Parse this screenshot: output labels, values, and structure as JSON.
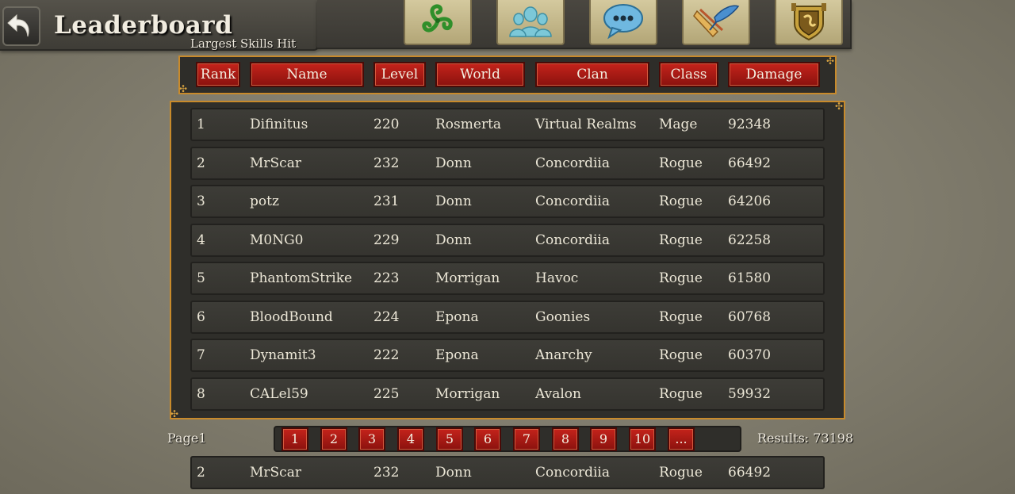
{
  "header": {
    "title": "Leaderboard",
    "subtitle": "Largest Skills Hit",
    "back_icon": "back-arrow-icon"
  },
  "menu": [
    {
      "name": "menu-button-skills",
      "icon": "triskelion-icon"
    },
    {
      "name": "menu-button-social",
      "icon": "friends-icon"
    },
    {
      "name": "menu-button-chat",
      "icon": "chat-bubble-icon"
    },
    {
      "name": "menu-button-quests",
      "icon": "scroll-quill-icon"
    },
    {
      "name": "menu-button-shop",
      "icon": "shield-emblem-icon"
    }
  ],
  "columns": [
    "Rank",
    "Name",
    "Level",
    "World",
    "Clan",
    "Class",
    "Damage"
  ],
  "rows": [
    {
      "rank": "1",
      "name": "Difinitus",
      "level": "220",
      "world": "Rosmerta",
      "clan": "Virtual Realms",
      "class": "Mage",
      "damage": "92348"
    },
    {
      "rank": "2",
      "name": "MrScar",
      "level": "232",
      "world": "Donn",
      "clan": "Concordiia",
      "class": "Rogue",
      "damage": "66492"
    },
    {
      "rank": "3",
      "name": "potz",
      "level": "231",
      "world": "Donn",
      "clan": "Concordiia",
      "class": "Rogue",
      "damage": "64206"
    },
    {
      "rank": "4",
      "name": "M0NG0",
      "level": "229",
      "world": "Donn",
      "clan": "Concordiia",
      "class": "Rogue",
      "damage": "62258"
    },
    {
      "rank": "5",
      "name": "PhantomStrike",
      "level": "223",
      "world": "Morrigan",
      "clan": "Havoc",
      "class": "Rogue",
      "damage": "61580"
    },
    {
      "rank": "6",
      "name": "BloodBound",
      "level": "224",
      "world": "Epona",
      "clan": "Goonies",
      "class": "Rogue",
      "damage": "60768"
    },
    {
      "rank": "7",
      "name": "Dynamit3",
      "level": "222",
      "world": "Epona",
      "clan": "Anarchy",
      "class": "Rogue",
      "damage": "60370"
    },
    {
      "rank": "8",
      "name": "CALel59",
      "level": "225",
      "world": "Morrigan",
      "clan": "Avalon",
      "class": "Rogue",
      "damage": "59932"
    }
  ],
  "pagination": {
    "page_label": "Page1",
    "pages": [
      "1",
      "2",
      "3",
      "4",
      "5",
      "6",
      "7",
      "8",
      "9",
      "10",
      "..."
    ],
    "results": "Results: 73198"
  },
  "my_rank": {
    "rank": "2",
    "name": "MrScar",
    "level": "232",
    "world": "Donn",
    "clan": "Concordiia",
    "class": "Rogue",
    "damage": "66492"
  },
  "colors": {
    "accent_gold": "#c88a2b",
    "button_red": "#a81a14",
    "panel_dark": "#2f2e2a",
    "background": "#858172"
  }
}
